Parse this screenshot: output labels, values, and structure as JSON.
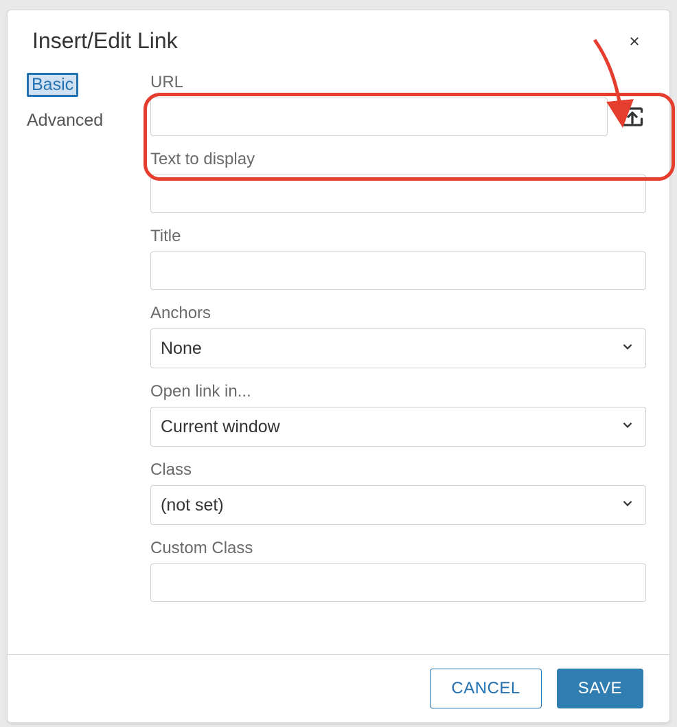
{
  "dialog": {
    "title": "Insert/Edit Link",
    "tabs": {
      "basic": "Basic",
      "advanced": "Advanced"
    },
    "fields": {
      "url": {
        "label": "URL",
        "value": ""
      },
      "text_to_display": {
        "label": "Text to display",
        "value": ""
      },
      "title": {
        "label": "Title",
        "value": ""
      },
      "anchors": {
        "label": "Anchors",
        "value": "None"
      },
      "open_link_in": {
        "label": "Open link in...",
        "value": "Current window"
      },
      "class": {
        "label": "Class",
        "value": "(not set)"
      },
      "custom_class": {
        "label": "Custom Class",
        "value": ""
      }
    },
    "footer": {
      "cancel": "CANCEL",
      "save": "SAVE"
    }
  }
}
